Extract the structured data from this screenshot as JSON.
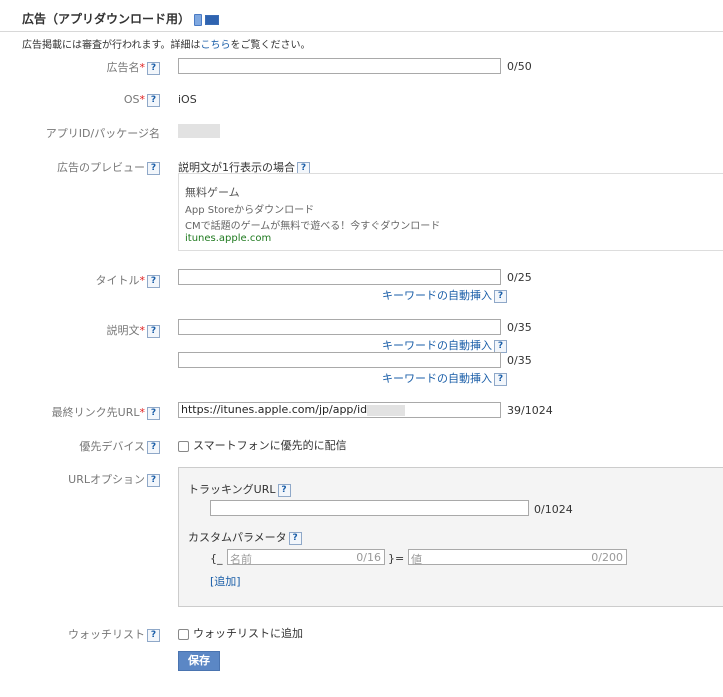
{
  "header": {
    "title": "広告（アプリダウンロード用）"
  },
  "notice": {
    "pre": "広告掲載には審査が行われます。詳細は",
    "link": "こちら",
    "post": "をご覧ください。"
  },
  "fields": {
    "ad_name": {
      "label": "広告名",
      "req": "*",
      "value": "",
      "counter": "0/50"
    },
    "os": {
      "label": "OS",
      "req": "*",
      "value": "iOS"
    },
    "app_id": {
      "label": "アプリID/パッケージ名"
    },
    "preview": {
      "label": "広告のプレビュー",
      "subhead": "説明文が1行表示の場合",
      "line1": "無料ゲーム",
      "line2": "App Storeからダウンロード",
      "line3": "CMで話題のゲームが無料で遊べる！今すぐダウンロード",
      "url": "itunes.apple.com"
    },
    "title": {
      "label": "タイトル",
      "req": "*",
      "counter": "0/25",
      "keyword_link": "キーワードの自動挿入"
    },
    "description": {
      "label": "説明文",
      "req": "*",
      "counter1": "0/35",
      "counter2": "0/35",
      "keyword_link1": "キーワードの自動挿入",
      "keyword_link2": "キーワードの自動挿入"
    },
    "final_url": {
      "label": "最終リンク先URL",
      "req": "*",
      "value": "https://itunes.apple.com/jp/app/id",
      "counter": "39/1024"
    },
    "device": {
      "label": "優先デバイス",
      "checkbox": "スマートフォンに優先的に配信"
    },
    "url_option": {
      "label": "URLオプション",
      "tracking_label": "トラッキングURL",
      "tracking_counter": "0/1024",
      "custom_label": "カスタムパラメータ",
      "brace_open": "{_",
      "name_placeholder": "名前",
      "name_counter": "0/16",
      "brace_close": "}=",
      "value_placeholder": "値",
      "value_counter": "0/200",
      "add_link": "[追加]"
    },
    "watchlist": {
      "label": "ウォッチリスト",
      "checkbox": "ウォッチリストに追加"
    }
  },
  "help_icon": "?",
  "save_button": "保存"
}
